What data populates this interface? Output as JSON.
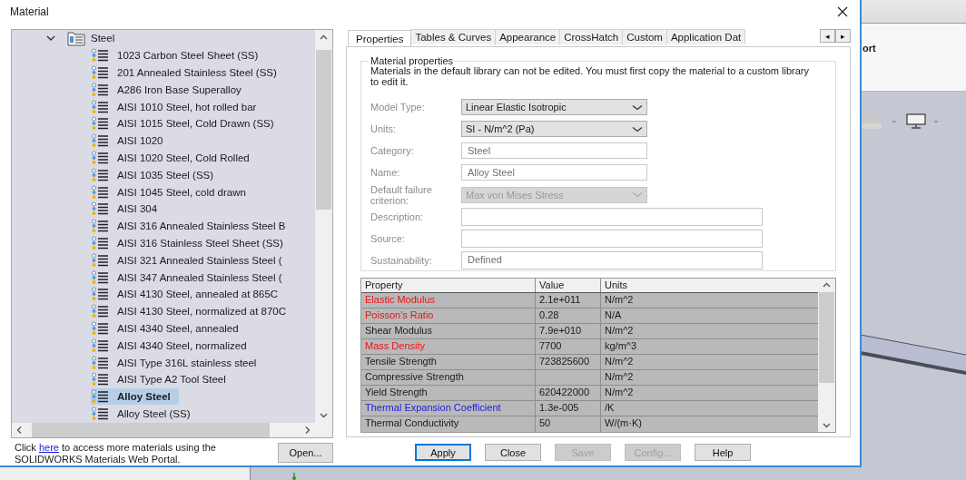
{
  "window": {
    "title": "Material"
  },
  "tree": {
    "label": "Steel",
    "expanded": true,
    "children": [
      {
        "label": "1023 Carbon Steel Sheet (SS)",
        "selected": false
      },
      {
        "label": "201 Annealed Stainless Steel (SS)",
        "selected": false
      },
      {
        "label": "A286 Iron Base Superalloy",
        "selected": false
      },
      {
        "label": "AISI 1010 Steel, hot rolled bar",
        "selected": false
      },
      {
        "label": "AISI 1015 Steel, Cold Drawn (SS)",
        "selected": false
      },
      {
        "label": "AISI 1020",
        "selected": false
      },
      {
        "label": "AISI 1020 Steel, Cold Rolled",
        "selected": false
      },
      {
        "label": "AISI 1035 Steel (SS)",
        "selected": false
      },
      {
        "label": "AISI 1045 Steel, cold drawn",
        "selected": false
      },
      {
        "label": "AISI 304",
        "selected": false
      },
      {
        "label": "AISI 316 Annealed Stainless Steel B",
        "selected": false
      },
      {
        "label": "AISI 316 Stainless Steel Sheet (SS)",
        "selected": false
      },
      {
        "label": "AISI 321 Annealed Stainless Steel (",
        "selected": false
      },
      {
        "label": "AISI 347 Annealed Stainless Steel (",
        "selected": false
      },
      {
        "label": "AISI 4130 Steel, annealed at 865C",
        "selected": false
      },
      {
        "label": "AISI 4130 Steel, normalized at 870C",
        "selected": false
      },
      {
        "label": "AISI 4340 Steel, annealed",
        "selected": false
      },
      {
        "label": "AISI 4340 Steel, normalized",
        "selected": false
      },
      {
        "label": "AISI Type 316L stainless steel",
        "selected": false
      },
      {
        "label": "AISI Type A2 Tool Steel",
        "selected": false
      },
      {
        "label": "Alloy Steel",
        "selected": true
      },
      {
        "label": "Alloy Steel (SS)",
        "selected": false
      }
    ]
  },
  "portal_note": {
    "before": "Click ",
    "link": "here",
    "after": " to access more materials using the SOLIDWORKS Materials Web Portal."
  },
  "open_button": "Open...",
  "tabs": [
    {
      "label": "Properties",
      "selected": true
    },
    {
      "label": "Tables & Curves",
      "selected": false
    },
    {
      "label": "Appearance",
      "selected": false
    },
    {
      "label": "CrossHatch",
      "selected": false
    },
    {
      "label": "Custom",
      "selected": false
    },
    {
      "label": "Application Dat",
      "selected": false
    }
  ],
  "tab_scroll": [
    "◂",
    "▸"
  ],
  "group": {
    "title": "Material properties",
    "notice": "Materials in the default library can not be edited. You must first copy the material to a custom library to edit it."
  },
  "form": [
    {
      "kind": "dropdown",
      "label": "Model Type:",
      "value": "Linear Elastic Isotropic",
      "disabled": false
    },
    {
      "kind": "dropdown",
      "label": "Units:",
      "value": "SI - N/m^2 (Pa)",
      "disabled": false
    },
    {
      "kind": "text",
      "label": "Category:",
      "value": "Steel"
    },
    {
      "kind": "text",
      "label": "Name:",
      "value": "Alloy Steel"
    },
    {
      "kind": "dropdown",
      "label": "Default failure criterion:",
      "value": "Max von Mises Stress",
      "disabled": true
    },
    {
      "kind": "wide",
      "label": "Description:"
    },
    {
      "kind": "wide",
      "label": "Source:"
    },
    {
      "kind": "wide",
      "label": "Sustainability:",
      "value": "Defined"
    }
  ],
  "table": {
    "columns": [
      "Property",
      "Value",
      "Units"
    ],
    "rows": [
      {
        "property": "Elastic Modulus",
        "value": "2.1e+011",
        "units": "N/m^2",
        "color": "#e8141c"
      },
      {
        "property": "Poisson's Ratio",
        "value": "0.28",
        "units": "N/A",
        "color": "#e8141c"
      },
      {
        "property": "Shear Modulus",
        "value": "7.9e+010",
        "units": "N/m^2",
        "color": "#1a1a1a"
      },
      {
        "property": "Mass Density",
        "value": "7700",
        "units": "kg/m^3",
        "color": "#e8141c"
      },
      {
        "property": "Tensile Strength",
        "value": "723825600",
        "units": "N/m^2",
        "color": "#1a1a1a"
      },
      {
        "property": "Compressive Strength",
        "units": "N/m^2",
        "color": "#1a1a1a"
      },
      {
        "property": "Yield Strength",
        "value": "620422000",
        "units": "N/m^2",
        "color": "#1a1a1a"
      },
      {
        "property": "Thermal Expansion Coefficient",
        "value": "1.3e-005",
        "units": "/K",
        "color": "#2020e0"
      },
      {
        "property": "Thermal Conductivity",
        "value": "50",
        "units": "W/(m·K)",
        "color": "#1a1a1a"
      }
    ]
  },
  "buttons": [
    {
      "label": "Apply",
      "disabled": false,
      "focused": true
    },
    {
      "label": "Close",
      "disabled": false,
      "focused": false
    },
    {
      "label": "Save",
      "disabled": true,
      "focused": false
    },
    {
      "label": "Config...",
      "disabled": true,
      "focused": false
    },
    {
      "label": "Help",
      "disabled": false,
      "focused": false
    }
  ],
  "background_app": {
    "ribbon_text": "ort"
  }
}
